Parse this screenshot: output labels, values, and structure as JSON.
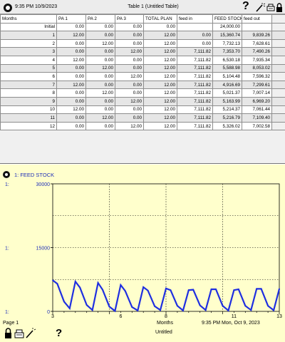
{
  "table_window": {
    "datetime": "9:35 PM  10/9/2023",
    "title": "Table 1 (Untitled Table)",
    "help_label": "?",
    "columns": [
      "Months",
      "PA 1",
      "PA 2",
      "PA 3",
      "TOTAL PLAN",
      "feed in",
      "FEED STOCK",
      "feed out"
    ],
    "rows": [
      [
        "Initial",
        "0.00",
        "0.00",
        "0.00",
        "0.00",
        "",
        "24,000.00",
        ""
      ],
      [
        "1",
        "12.00",
        "0.00",
        "0.00",
        "12.00",
        "0.00",
        "15,360.74",
        "9,839.26"
      ],
      [
        "2",
        "0.00",
        "12.00",
        "0.00",
        "12.00",
        "0.00",
        "7,732.13",
        "7,628.61"
      ],
      [
        "3",
        "0.00",
        "0.00",
        "12.00",
        "12.00",
        "7,111.82",
        "7,353.70",
        "7,490.26"
      ],
      [
        "4",
        "12.00",
        "0.00",
        "0.00",
        "12.00",
        "7,111.82",
        "6,530.18",
        "7,935.34"
      ],
      [
        "5",
        "0.00",
        "12.00",
        "0.00",
        "12.00",
        "7,111.82",
        "5,588.98",
        "8,053.02"
      ],
      [
        "6",
        "0.00",
        "0.00",
        "12.00",
        "12.00",
        "7,111.82",
        "5,104.48",
        "7,596.32"
      ],
      [
        "7",
        "12.00",
        "0.00",
        "0.00",
        "12.00",
        "7,111.82",
        "4,916.69",
        "7,299.61"
      ],
      [
        "8",
        "0.00",
        "12.00",
        "0.00",
        "12.00",
        "7,111.82",
        "5,021.37",
        "7,007.14"
      ],
      [
        "9",
        "0.00",
        "0.00",
        "12.00",
        "12.00",
        "7,111.82",
        "5,163.99",
        "6,969.20"
      ],
      [
        "10",
        "12.00",
        "0.00",
        "0.00",
        "12.00",
        "7,111.82",
        "5,214.37",
        "7,061.44"
      ],
      [
        "11",
        "0.00",
        "12.00",
        "0.00",
        "12.00",
        "7,111.82",
        "5,216.79",
        "7,109.40"
      ],
      [
        "12",
        "0.00",
        "0.00",
        "12.00",
        "12.00",
        "7,111.82",
        "5,326.02",
        "7,002.58"
      ]
    ]
  },
  "graph_window": {
    "legend": "1: FEED STOCK",
    "page_label": "Page 1",
    "time_label": "Months",
    "subtitle": "Untitled",
    "footer_datetime": "9:35 PM   Mon, Oct 9, 2023",
    "help_label": "?"
  },
  "colors": {
    "line": "#1f2fe0",
    "graph_bg": "#ffffcc",
    "title_blue": "#1f2fb8",
    "row_shade": "#e6e6e6"
  },
  "chart_data": {
    "type": "line",
    "series": [
      {
        "name": "1: FEED STOCK",
        "x": [
          3.0,
          3.2,
          3.5,
          3.75,
          4.0,
          4.2,
          4.5,
          4.75,
          5.0,
          5.2,
          5.5,
          5.75,
          6.0,
          6.2,
          6.5,
          6.75,
          7.0,
          7.2,
          7.5,
          7.75,
          8.0,
          8.2,
          8.5,
          8.75,
          9.0,
          9.2,
          9.5,
          9.75,
          10.0,
          10.2,
          10.5,
          10.75,
          11.0,
          11.2,
          11.5,
          11.75,
          12.0,
          12.2,
          12.5,
          12.75,
          13.0
        ],
        "y": [
          7300,
          6500,
          2300,
          700,
          7000,
          5600,
          1500,
          300,
          6700,
          5100,
          1100,
          100,
          6200,
          4800,
          1000,
          200,
          5700,
          4900,
          1200,
          300,
          5400,
          5000,
          1300,
          200,
          5000,
          5100,
          1400,
          300,
          5200,
          5200,
          1300,
          200,
          5000,
          5200,
          1300,
          300,
          5300,
          5300,
          1300,
          250,
          5300
        ]
      }
    ],
    "xlabel": "Months",
    "y_ticks": [
      "30000",
      "15000",
      "0"
    ],
    "y_tick_series_labels": [
      "1:",
      "1:",
      "1:"
    ],
    "x_ticks": [
      3,
      6,
      8,
      11,
      13
    ],
    "xlim": [
      3,
      13
    ],
    "ylim": [
      0,
      30000
    ],
    "grid": true
  }
}
